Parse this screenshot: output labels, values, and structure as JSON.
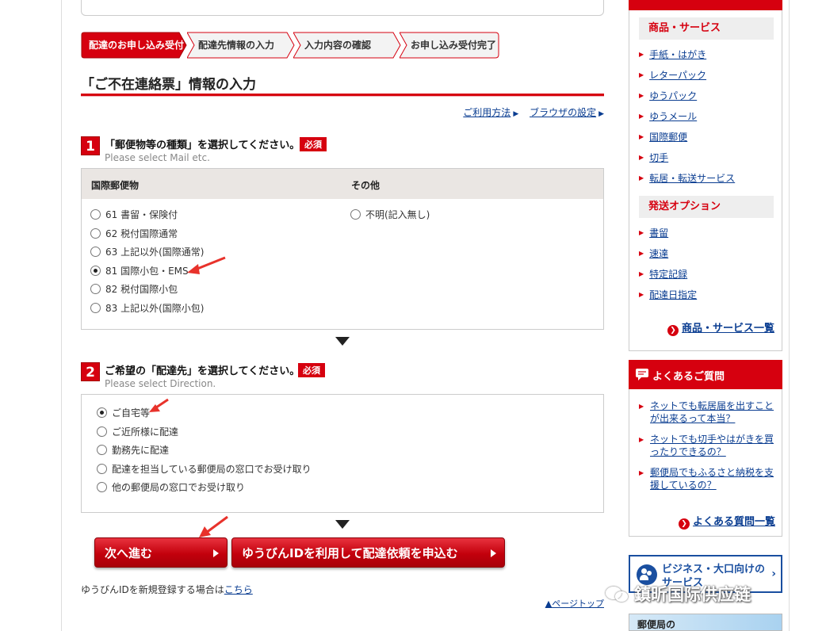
{
  "steps": [
    {
      "label": "配達のお申し込み受付",
      "active": true
    },
    {
      "label": "配達先情報の入力",
      "active": false
    },
    {
      "label": "入力内容の確認",
      "active": false
    },
    {
      "label": "お申し込み受付完了",
      "active": false
    }
  ],
  "page_title": "「ご不在連絡票」情報の入力",
  "util_links": {
    "usage": "ご利用方法",
    "browser": "ブラウザの設定"
  },
  "section1": {
    "number": "1",
    "title": "「郵便物等の種類」を選択してください。",
    "subtitle": "Please select Mail etc.",
    "required": "必須",
    "col1_header": "国際郵便物",
    "col2_header": "その他",
    "col1_options": [
      {
        "label": "61 書留・保険付",
        "checked": false
      },
      {
        "label": "62 税付国際通常",
        "checked": false
      },
      {
        "label": "63 上記以外(国際通常)",
        "checked": false
      },
      {
        "label": "81 国際小包・EMS",
        "checked": true
      },
      {
        "label": "82 税付国際小包",
        "checked": false
      },
      {
        "label": "83 上記以外(国際小包)",
        "checked": false
      }
    ],
    "col2_options": [
      {
        "label": "不明(記入無し)",
        "checked": false
      }
    ]
  },
  "section2": {
    "number": "2",
    "title": "ご希望の「配達先」を選択してください。",
    "subtitle": "Please select Direction.",
    "required": "必須",
    "options": [
      {
        "label": "ご自宅等",
        "checked": true
      },
      {
        "label": "ご近所様に配達",
        "checked": false
      },
      {
        "label": "勤務先に配達",
        "checked": false
      },
      {
        "label": "配達を担当している郵便局の窓口でお受け取り",
        "checked": false
      },
      {
        "label": "他の郵便局の窓口でお受け取り",
        "checked": false
      }
    ]
  },
  "buttons": {
    "next": "次へ進む",
    "yubin_id": "ゆうびんIDを利用して配達依頼を申込む"
  },
  "register_note": {
    "text": "ゆうびんIDを新規登録する場合は",
    "link": "こちら"
  },
  "page_top": "▲ページトップ",
  "sidebar": {
    "cat_products": "商品・サービス",
    "products": [
      "手紙・はがき",
      "レターパック",
      "ゆうパック",
      "ゆうメール",
      "国際郵便",
      "切手",
      "転居・転送サービス"
    ],
    "cat_options": "発送オプション",
    "options": [
      "書留",
      "速達",
      "特定記録",
      "配達日指定"
    ],
    "products_all": "商品・サービス一覧",
    "faq_title": "よくあるご質問",
    "faq_items": [
      "ネットでも転居届を出すことが出来るって本当？",
      "ネットでも切手やはがきを買ったりできるの？",
      "郵便局でもふるさと納税を支援しているの？"
    ],
    "faq_all": "よくある質問一覧",
    "business_banner": "ビジネス・大口向けのサービス",
    "post_office_banner": "郵便局の"
  },
  "watermark": "鎮昕国际供应链",
  "colors": {
    "brand_red": "#d6000f",
    "link_blue": "#0a3d91",
    "head_gray": "#eae6e3"
  }
}
